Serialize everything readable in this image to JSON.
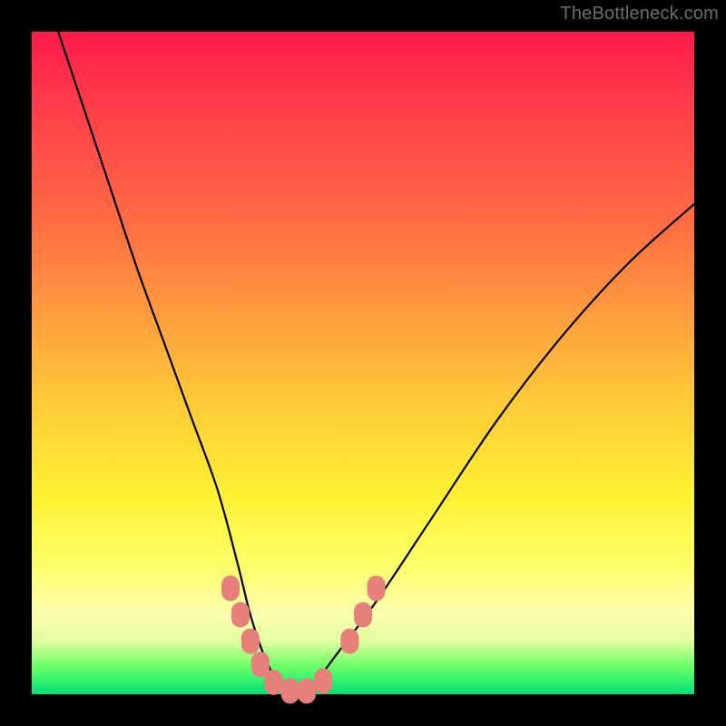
{
  "watermark": "TheBottleneck.com",
  "chart_data": {
    "type": "line",
    "title": "",
    "xlabel": "",
    "ylabel": "",
    "xlim": [
      0,
      100
    ],
    "ylim": [
      0,
      100
    ],
    "legend": false,
    "grid": false,
    "background": "rainbow-vertical-gradient",
    "series": [
      {
        "name": "bottleneck-curve",
        "x": [
          4,
          8,
          12,
          16,
          20,
          24,
          28,
          31,
          33,
          35,
          37,
          39,
          41,
          43,
          46,
          52,
          60,
          70,
          80,
          90,
          100
        ],
        "y": [
          100,
          88,
          76,
          64,
          53,
          42,
          31,
          20,
          12,
          6,
          2,
          0,
          0,
          2,
          6,
          14,
          26,
          41,
          54,
          65,
          74
        ]
      }
    ],
    "markers": [
      {
        "name": "left-cluster",
        "shape": "rounded-capsule",
        "color": "#e77f7a",
        "points": [
          {
            "x": 30.0,
            "y": 16.0
          },
          {
            "x": 31.5,
            "y": 12.0
          },
          {
            "x": 33.0,
            "y": 8.0
          },
          {
            "x": 34.5,
            "y": 4.5
          },
          {
            "x": 36.5,
            "y": 1.8
          },
          {
            "x": 39.0,
            "y": 0.5
          },
          {
            "x": 41.5,
            "y": 0.5
          },
          {
            "x": 44.0,
            "y": 2.0
          }
        ]
      },
      {
        "name": "right-cluster",
        "shape": "rounded-capsule",
        "color": "#e77f7a",
        "points": [
          {
            "x": 48.0,
            "y": 8.0
          },
          {
            "x": 50.0,
            "y": 12.0
          },
          {
            "x": 52.0,
            "y": 16.0
          }
        ]
      }
    ]
  }
}
